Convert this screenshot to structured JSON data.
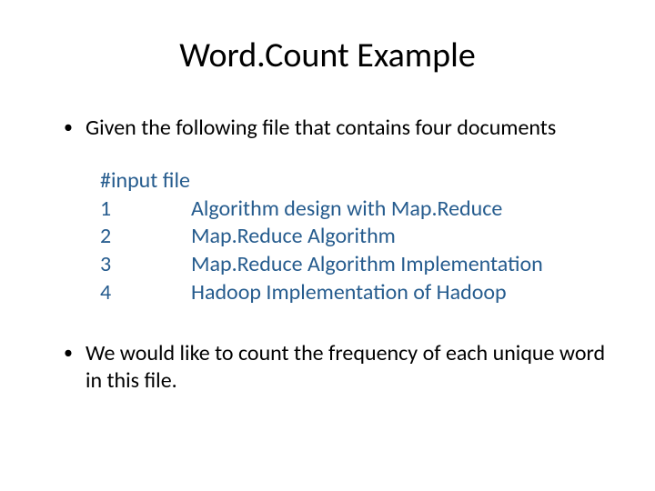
{
  "title": "Word.Count Example",
  "bullets": {
    "first": "Given the following file that contains four documents",
    "second": "We would like to count the frequency of each unique word in this file."
  },
  "file": {
    "header": "#input file",
    "rows": [
      {
        "id": "1",
        "doc": "Algorithm design with Map.Reduce"
      },
      {
        "id": "2",
        "doc": "Map.Reduce Algorithm"
      },
      {
        "id": "3",
        "doc": "Map.Reduce Algorithm Implementation"
      },
      {
        "id": "4",
        "doc": "Hadoop Implementation of Hadoop"
      }
    ]
  }
}
